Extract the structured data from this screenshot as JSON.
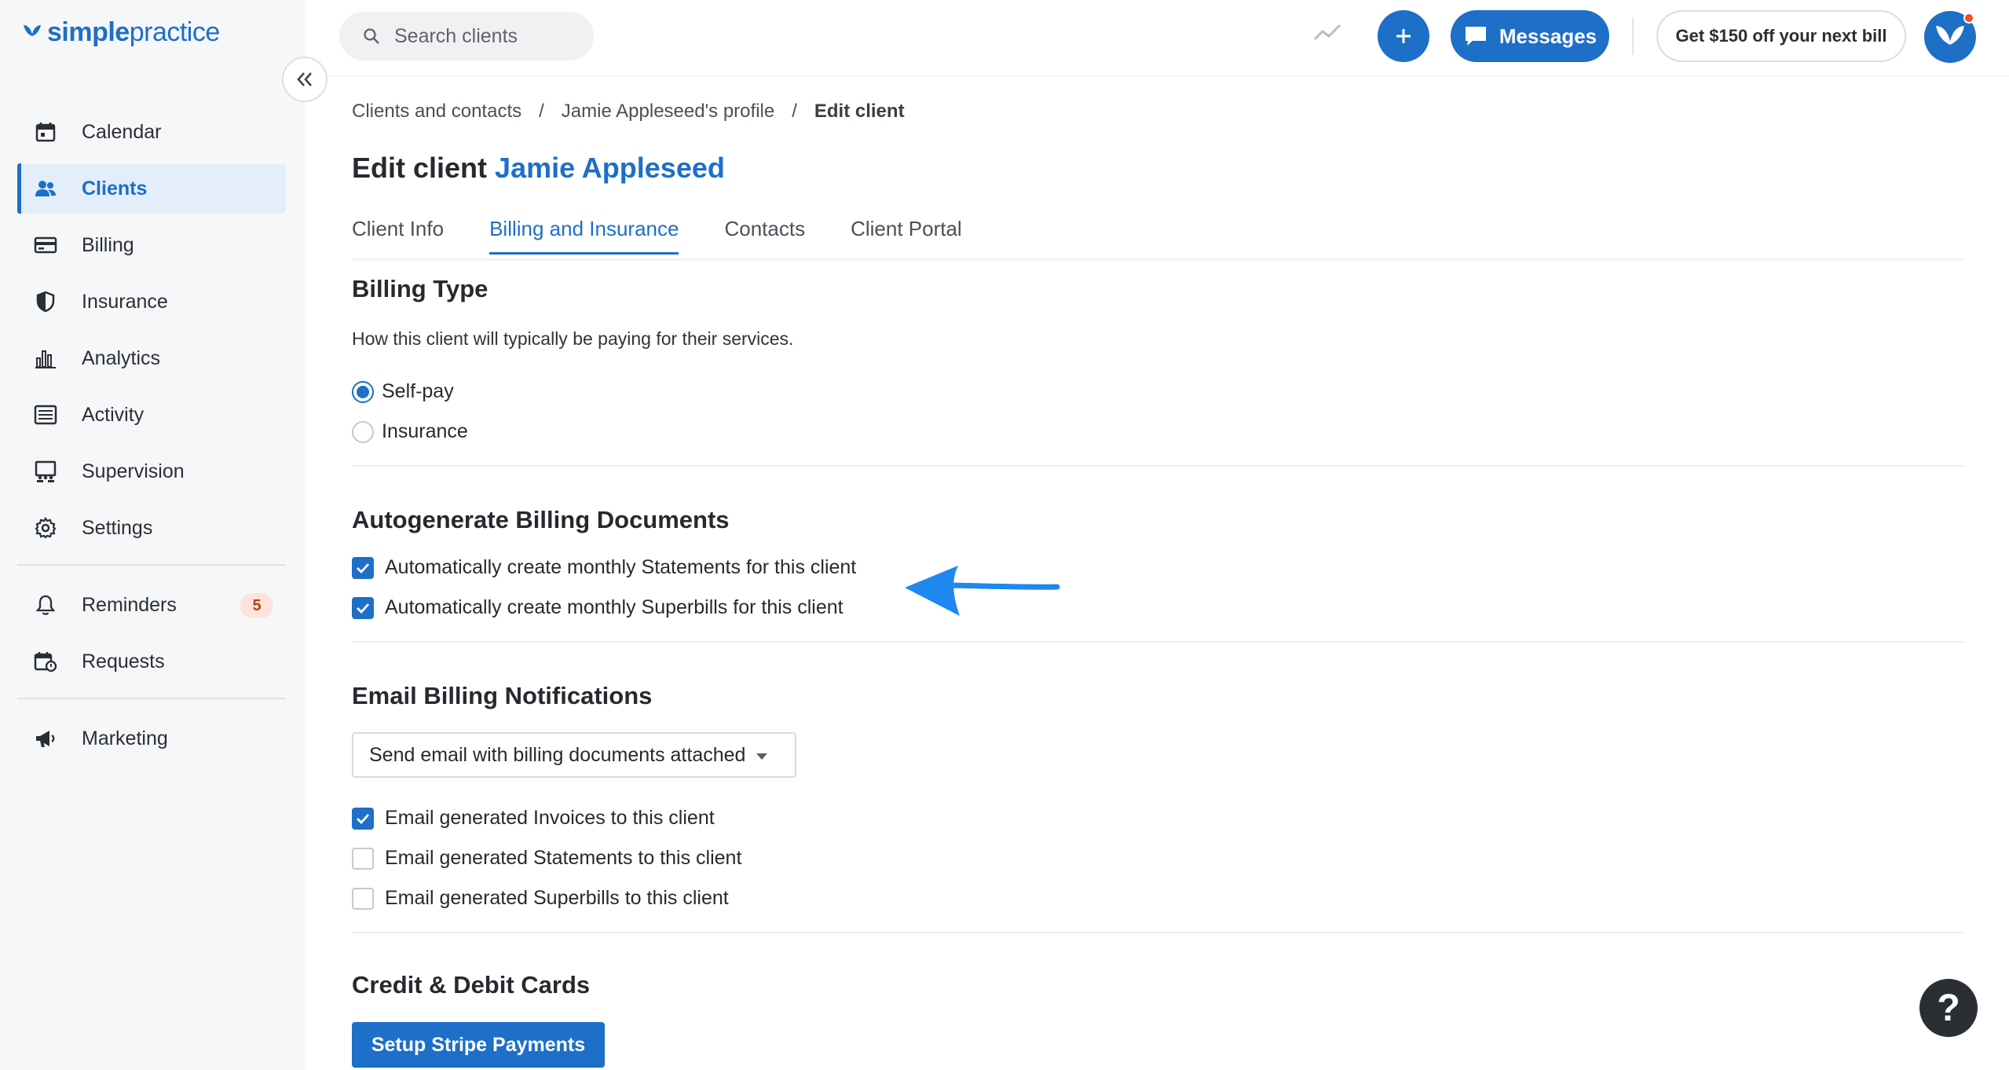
{
  "app": {
    "logo_text": "simplepractice",
    "brand_color": "#1d6fc7"
  },
  "sidebar": {
    "items": [
      {
        "label": "Calendar",
        "icon": "calendar-icon"
      },
      {
        "label": "Clients",
        "icon": "users-icon",
        "active": true
      },
      {
        "label": "Billing",
        "icon": "credit-card-icon"
      },
      {
        "label": "Insurance",
        "icon": "shield-icon"
      },
      {
        "label": "Analytics",
        "icon": "bar-chart-icon"
      },
      {
        "label": "Activity",
        "icon": "list-icon"
      },
      {
        "label": "Supervision",
        "icon": "supervision-icon"
      },
      {
        "label": "Settings",
        "icon": "gear-icon"
      }
    ],
    "secondary": [
      {
        "label": "Reminders",
        "icon": "bell-icon",
        "badge": "5"
      },
      {
        "label": "Requests",
        "icon": "calendar-request-icon"
      }
    ],
    "tertiary": [
      {
        "label": "Marketing",
        "icon": "megaphone-icon"
      }
    ]
  },
  "topbar": {
    "search_placeholder": "Search clients",
    "messages_label": "Messages",
    "promo_label": "Get $150 off your next bill"
  },
  "breadcrumb": {
    "items": [
      "Clients and contacts",
      "Jamie Appleseed's profile",
      "Edit client"
    ],
    "separator": "/"
  },
  "page": {
    "title_prefix": "Edit client",
    "client_name": "Jamie Appleseed"
  },
  "tabs": [
    {
      "label": "Client Info",
      "active": false
    },
    {
      "label": "Billing and Insurance",
      "active": true
    },
    {
      "label": "Contacts",
      "active": false
    },
    {
      "label": "Client Portal",
      "active": false
    }
  ],
  "billing_type": {
    "title": "Billing Type",
    "description": "How this client will typically be paying for their services.",
    "options": [
      {
        "label": "Self-pay",
        "checked": true
      },
      {
        "label": "Insurance",
        "checked": false
      }
    ]
  },
  "autogenerate": {
    "title": "Autogenerate Billing Documents",
    "options": [
      {
        "label": "Automatically create monthly Statements for this client",
        "checked": true
      },
      {
        "label": "Automatically create monthly Superbills for this client",
        "checked": true
      }
    ]
  },
  "email_notifications": {
    "title": "Email Billing Notifications",
    "select_value": "Send email with billing documents attached",
    "options": [
      {
        "label": "Email generated Invoices to this client",
        "checked": true
      },
      {
        "label": "Email generated Statements to this client",
        "checked": false
      },
      {
        "label": "Email generated Superbills to this client",
        "checked": false
      }
    ]
  },
  "cards": {
    "title": "Credit & Debit Cards",
    "button_label": "Setup Stripe Payments"
  },
  "help": {
    "label": "?"
  }
}
